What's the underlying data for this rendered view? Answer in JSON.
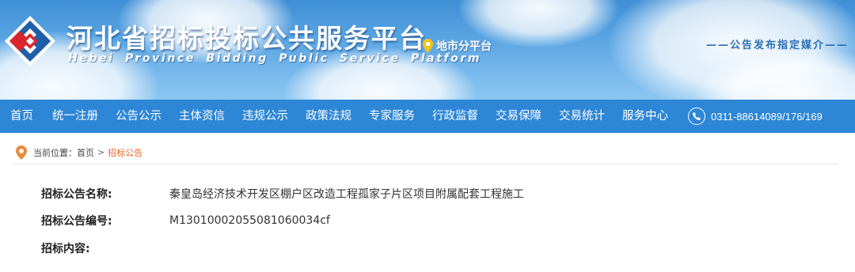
{
  "header": {
    "title": "河北省招标投标公共服务平台",
    "subtitle": "Hebei Province Bidding Public Service Platform",
    "city_link": "地市分平台",
    "notice_media": "——公告发布指定媒介——"
  },
  "nav": {
    "items": [
      "首页",
      "统一注册",
      "公告公示",
      "主体资信",
      "违规公示",
      "政策法规",
      "专家服务",
      "行政监督",
      "交易保障",
      "交易统计",
      "服务中心"
    ],
    "phone": "0311-88614089/176/169"
  },
  "breadcrumb": {
    "prefix": "当前位置：",
    "home": "首页",
    "separator": ">",
    "current": "招标公告"
  },
  "announcement": {
    "name_label": "招标公告名称:",
    "name_value": "秦皇岛经济技术开发区棚户区改造工程孤家子片区项目附属配套工程施工",
    "code_label": "招标公告编号:",
    "code_value": "M1301000205508106003​4cf",
    "content_label": "招标内容:"
  },
  "colors": {
    "nav_bg": "#2d86d6",
    "breadcrumb_current": "#e8622a",
    "pin": "#e8893a",
    "city_pin": "#f5c518"
  },
  "icons": {
    "logo": "diamond-logo-icon",
    "city": "location-pin-icon",
    "phone": "phone-icon",
    "breadcrumb": "location-pin-icon"
  }
}
